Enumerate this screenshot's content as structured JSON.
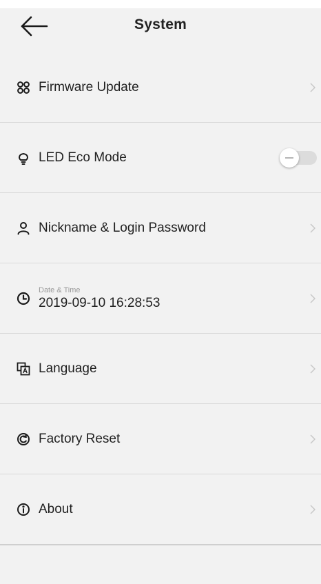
{
  "header": {
    "title": "System",
    "back_icon": "arrow-left-icon"
  },
  "settings": {
    "items": [
      {
        "id": "firmware",
        "icon": "firmware-icon",
        "label": "Firmware Update",
        "control": "chevron"
      },
      {
        "id": "led-eco",
        "icon": "bulb-icon",
        "label": "LED Eco Mode",
        "control": "toggle",
        "toggle_on": false
      },
      {
        "id": "nickname",
        "icon": "user-icon",
        "label": "Nickname & Login Password",
        "control": "chevron"
      },
      {
        "id": "datetime",
        "icon": "clock-icon",
        "caption": "Date & Time",
        "value": "2019-09-10 16:28:53",
        "control": "chevron"
      },
      {
        "id": "language",
        "icon": "language-icon",
        "label": "Language",
        "control": "chevron"
      },
      {
        "id": "factory-reset",
        "icon": "reset-icon",
        "label": "Factory Reset",
        "control": "chevron"
      },
      {
        "id": "about",
        "icon": "info-icon",
        "label": "About",
        "control": "chevron"
      }
    ]
  },
  "colors": {
    "background": "#f2f2f2",
    "divider": "#d9d9d9",
    "text": "#1f1f1f",
    "caption": "#9a9a9a",
    "chevron": "#c8c8c8",
    "toggle_track_off": "#dcdcdc"
  }
}
